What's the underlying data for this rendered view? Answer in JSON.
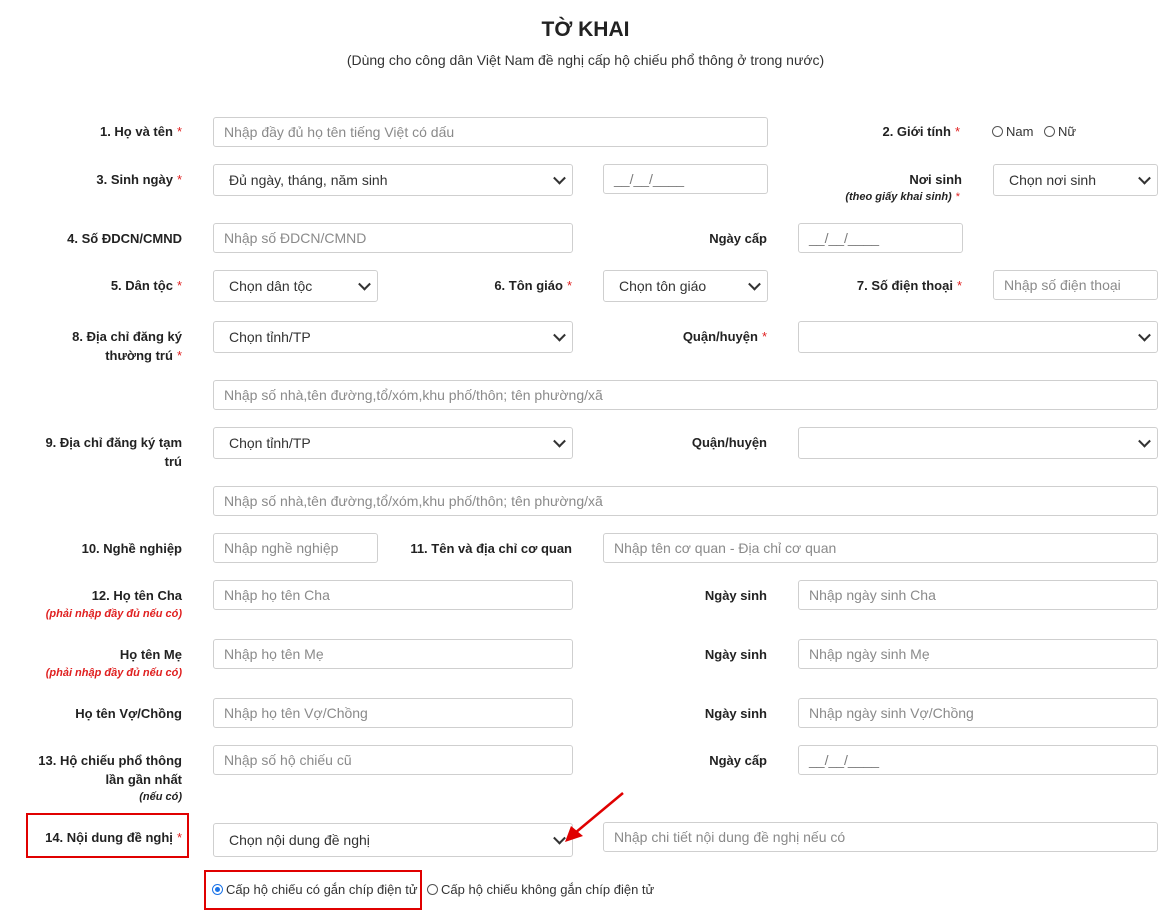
{
  "header": {
    "title": "TỜ KHAI",
    "subtitle": "(Dùng cho công dân Việt Nam đề nghị cấp hộ chiếu phổ thông ở trong nước)"
  },
  "required_mark": "*",
  "fields": {
    "full_name": {
      "label": "1. Họ và tên",
      "placeholder": "Nhập đầy đủ họ tên tiếng Việt có dấu"
    },
    "gender": {
      "label": "2. Giới tính",
      "options": [
        "Nam",
        "Nữ"
      ]
    },
    "dob": {
      "label": "3. Sinh ngày",
      "select_value": "Đủ ngày, tháng, năm sinh",
      "date_mask": "__/__/____"
    },
    "birthplace": {
      "label": "Nơi sinh",
      "hint": "(theo giấy khai sinh)",
      "select_value": "Chọn nơi sinh"
    },
    "id_number": {
      "label": "4. Số ĐDCN/CMND",
      "placeholder": "Nhập số ĐDCN/CMND"
    },
    "issue_date": {
      "label": "Ngày cấp",
      "date_mask": "__/__/____"
    },
    "ethnicity": {
      "label": "5. Dân tộc",
      "select_value": "Chọn dân tộc"
    },
    "religion": {
      "label": "6. Tôn giáo",
      "select_value": "Chọn tôn giáo"
    },
    "phone": {
      "label": "7. Số điện thoại",
      "placeholder": "Nhập số điện thoại"
    },
    "permanent_address": {
      "label_line1": "8. Địa chỉ đăng ký",
      "label_line2": "thường trú",
      "province_value": "Chọn tỉnh/TP",
      "district_label": "Quận/huyện",
      "district_value": "",
      "street_placeholder": "Nhập số nhà,tên đường,tổ/xóm,khu phố/thôn; tên phường/xã"
    },
    "temporary_address": {
      "label_line1": "9. Địa chỉ đăng ký tạm",
      "label_line2": "trú",
      "province_value": "Chọn tỉnh/TP",
      "district_label": "Quận/huyện",
      "district_value": "",
      "street_placeholder": "Nhập số nhà,tên đường,tổ/xóm,khu phố/thôn; tên phường/xã"
    },
    "occupation": {
      "label": "10. Nghề nghiệp",
      "placeholder": "Nhập nghề nghiệp"
    },
    "workplace": {
      "label": "11. Tên và địa chỉ cơ quan",
      "placeholder": "Nhập tên cơ quan - Địa chỉ cơ quan"
    },
    "father": {
      "label": "12. Họ tên Cha",
      "hint": "(phải nhập đầy đủ nếu có)",
      "placeholder": "Nhập họ tên Cha",
      "dob_label": "Ngày sinh",
      "dob_placeholder": "Nhập ngày sinh Cha"
    },
    "mother": {
      "label": "Họ tên Mẹ",
      "hint": "(phải nhập đầy đủ nếu có)",
      "placeholder": "Nhập họ tên Mẹ",
      "dob_label": "Ngày sinh",
      "dob_placeholder": "Nhập ngày sinh Mẹ"
    },
    "spouse": {
      "label": "Họ tên Vợ/Chồng",
      "placeholder": "Nhập họ tên Vợ/Chồng",
      "dob_label": "Ngày sinh",
      "dob_placeholder": "Nhập ngày sinh Vợ/Chồng"
    },
    "last_passport": {
      "label_line1": "13. Hộ chiếu phổ thông",
      "label_line2": "lần gần nhất",
      "hint": "(nếu có)",
      "placeholder": "Nhập số hộ chiếu cũ",
      "issue_label": "Ngày cấp",
      "date_mask": "__/__/____"
    },
    "request": {
      "label": "14. Nội dung đề nghị",
      "select_value": "Chọn nội dung đề nghị",
      "detail_placeholder": "Nhập chi tiết nội dung đề nghị nếu có",
      "option_chip": "Cấp hộ chiếu có gắn chíp điện tử",
      "option_no_chip": "Cấp hộ chiếu không gắn chíp điện tử"
    }
  },
  "colors": {
    "required": "#e02020",
    "annotation": "#e00000",
    "radio_checked": "#1a73e8"
  }
}
